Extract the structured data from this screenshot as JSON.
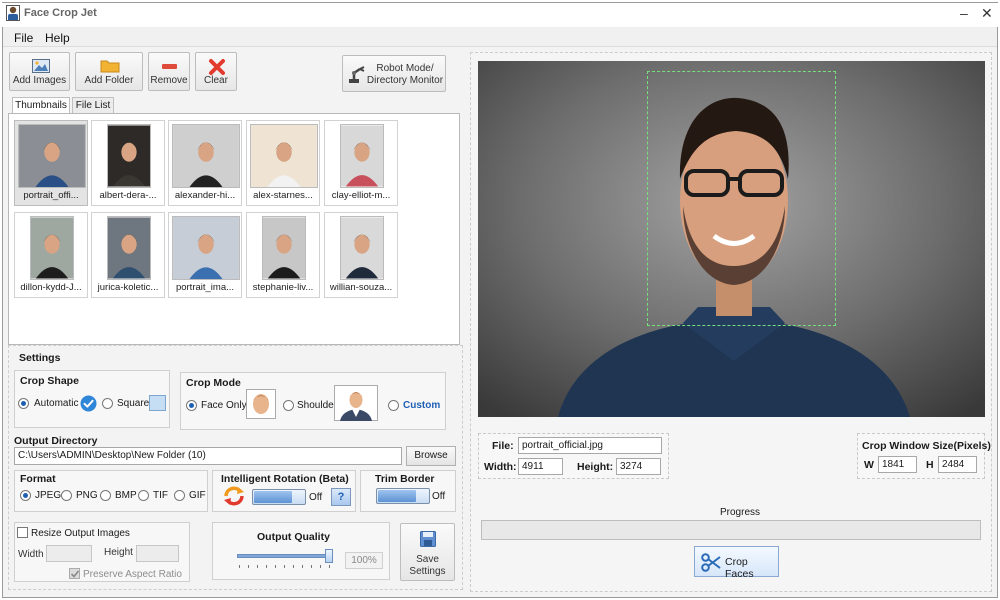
{
  "app": {
    "title": "Face Crop Jet"
  },
  "window_controls": {
    "minimize": "–",
    "close": "✕"
  },
  "menu": {
    "file": "File",
    "help": "Help"
  },
  "toolbar": {
    "add_images": "Add Images",
    "add_folder": "Add Folder",
    "remove": "Remove",
    "clear": "Clear",
    "robot_line1": "Robot Mode/",
    "robot_line2": "Directory Monitor"
  },
  "tabs": {
    "thumbnails": "Thumbnails",
    "file_list": "File List"
  },
  "thumbnails": [
    {
      "label": "portrait_offi...",
      "bg": "#8b8f95",
      "shirt": "#2a4f86",
      "hair": "#2a221c",
      "selected": true
    },
    {
      "label": "albert-dera-...",
      "bg": "#2d2a28",
      "shirt": "#3a3632",
      "hair": "#1e1813",
      "selected": false
    },
    {
      "label": "alexander-hi...",
      "bg": "#cfcfcf",
      "shirt": "#222222",
      "hair": "#3a2a1e",
      "selected": false
    },
    {
      "label": "alex-starnes...",
      "bg": "#efe4d3",
      "shirt": "#f2f2f2",
      "hair": "#2c1a12",
      "selected": false
    },
    {
      "label": "clay-elliot-m...",
      "bg": "#d8d8d8",
      "shirt": "#c8505c",
      "hair": "#2a1a14",
      "selected": false
    },
    {
      "label": "dillon-kydd-J...",
      "bg": "#9ea8a0",
      "shirt": "#1d1d1d",
      "hair": "#2a1e18",
      "selected": false
    },
    {
      "label": "jurica-koletic...",
      "bg": "#6e7680",
      "shirt": "#2f4f6e",
      "hair": "#2a221c",
      "selected": false
    },
    {
      "label": "portrait_ima...",
      "bg": "#c7cdd6",
      "shirt": "#3a6fb0",
      "hair": "#2a221c",
      "selected": false
    },
    {
      "label": "stephanie-liv...",
      "bg": "#c7c7c7",
      "shirt": "#1c1c1c",
      "hair": "#3a2618",
      "selected": false
    },
    {
      "label": "willian-souza...",
      "bg": "#d9d9d9",
      "shirt": "#1f2a3a",
      "hair": "#1a1410",
      "selected": false
    }
  ],
  "settings": {
    "heading": "Settings",
    "crop_shape": {
      "label": "Crop Shape",
      "automatic": "Automatic",
      "square": "Square",
      "selected": "Automatic"
    },
    "crop_mode": {
      "label": "Crop Mode",
      "face_only": "Face Only",
      "shoulder": "Shoulder",
      "custom": "Custom",
      "selected": "Face Only"
    },
    "output_directory": {
      "label": "Output Directory",
      "value": "C:\\Users\\ADMIN\\Desktop\\New Folder (10)",
      "browse": "Browse"
    },
    "format": {
      "label": "Format",
      "options": [
        "JPEG",
        "PNG",
        "BMP",
        "TIF",
        "GIF"
      ],
      "selected": "JPEG"
    },
    "rotation": {
      "label": "Intelligent Rotation (Beta)",
      "state": "Off",
      "help": "?"
    },
    "trim": {
      "label": "Trim Border",
      "state": "Off"
    },
    "resize": {
      "label": "Resize Output Images",
      "width_label": "Width",
      "height_label": "Height",
      "width_value": "",
      "height_value": "",
      "preserve": "Preserve Aspect Ratio"
    },
    "quality": {
      "label": "Output Quality",
      "value": "100%",
      "fraction": 1.0
    },
    "save": {
      "line1": "Save",
      "line2": "Settings"
    }
  },
  "info": {
    "file_label": "File:",
    "file_value": "portrait_official.jpg",
    "width_label": "Width:",
    "width_value": "4911",
    "height_label": "Height:",
    "height_value": "3274",
    "crop_window_label": "Crop Window Size(Pixels)",
    "w_label": "W",
    "w_value": "1841",
    "h_label": "H",
    "h_value": "2484"
  },
  "progress": {
    "label": "Progress",
    "value": 0
  },
  "crop_button": {
    "label": "Crop Faces"
  },
  "colors": {
    "accent": "#1e5fb4",
    "crop_outline": "#76e07c",
    "clear_x": "#e23b2e",
    "remove": "#e04a3a"
  }
}
